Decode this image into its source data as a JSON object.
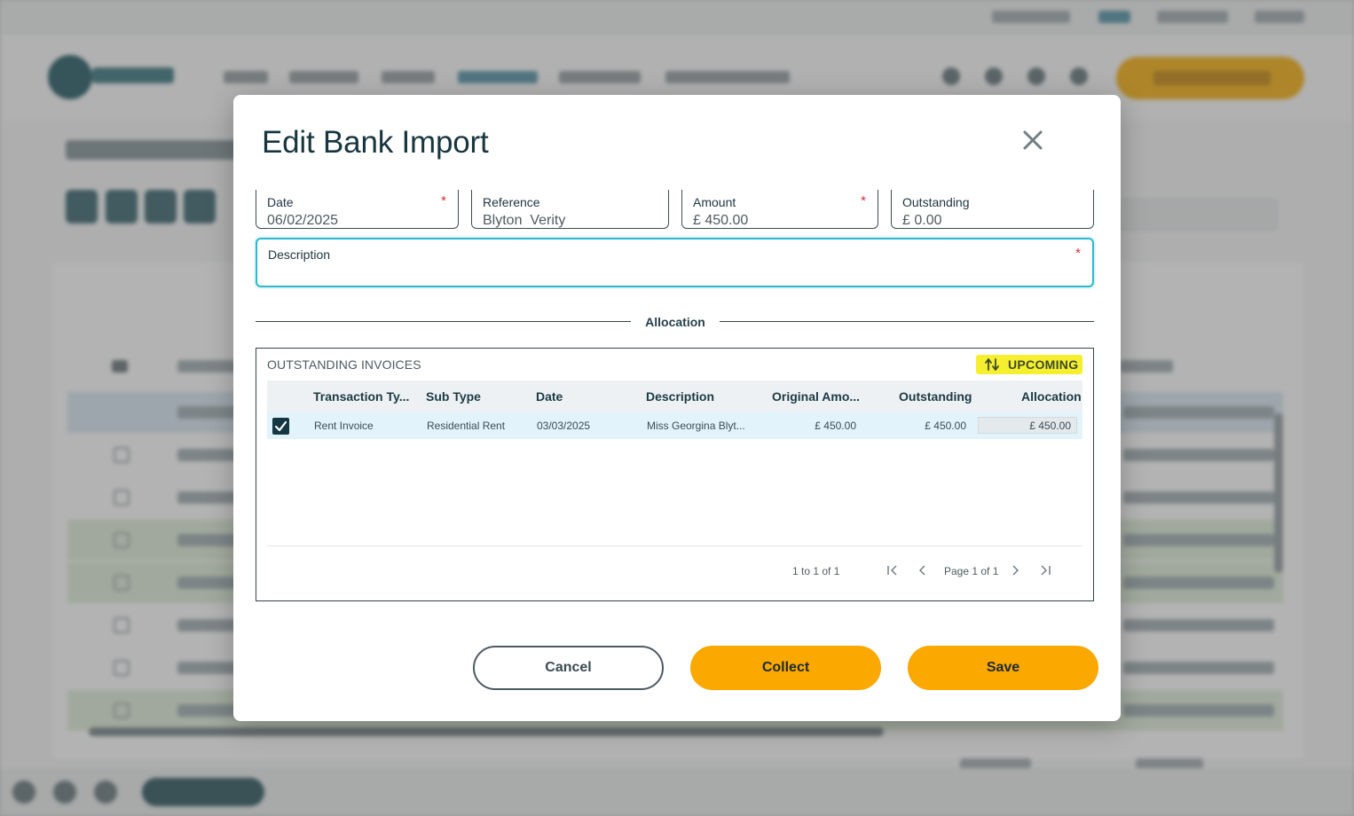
{
  "modal": {
    "title": "Edit Bank Import",
    "fields": {
      "date": {
        "label": "Date",
        "value": "06/02/2025",
        "required_mark": "*"
      },
      "reference": {
        "label": "Reference",
        "value": "Blyton  Verity"
      },
      "amount": {
        "label": "Amount",
        "value": "£ 450.00",
        "required_mark": "*"
      },
      "outstanding": {
        "label": "Outstanding",
        "value": "£ 0.00"
      },
      "description": {
        "label": "Description",
        "value": "",
        "required_mark": "*"
      }
    },
    "allocation_label": "Allocation",
    "outstanding_invoices": {
      "title": "OUTSTANDING INVOICES",
      "upcoming_label": "UPCOMING",
      "columns": [
        "Transaction Ty...",
        "Sub Type",
        "Date",
        "Description",
        "Original Amo...",
        "Outstanding",
        "Allocation"
      ],
      "rows": [
        {
          "checked": true,
          "transaction_type": "Rent Invoice",
          "sub_type": "Residential Rent",
          "date": "03/03/2025",
          "description": "Miss Georgina Blyt...",
          "original_amount": "£ 450.00",
          "outstanding": "£ 450.00",
          "allocation": "£ 450.00"
        }
      ],
      "pagination": {
        "range": "1 to 1 of 1",
        "page": "Page 1 of 1"
      }
    },
    "buttons": {
      "cancel": "Cancel",
      "collect": "Collect",
      "save": "Save"
    }
  },
  "colors": {
    "accent_yellow": "#fba800",
    "highlight_yellow": "#f5ef30",
    "focus_cyan": "#2cb9d0",
    "dark_teal": "#153743"
  }
}
